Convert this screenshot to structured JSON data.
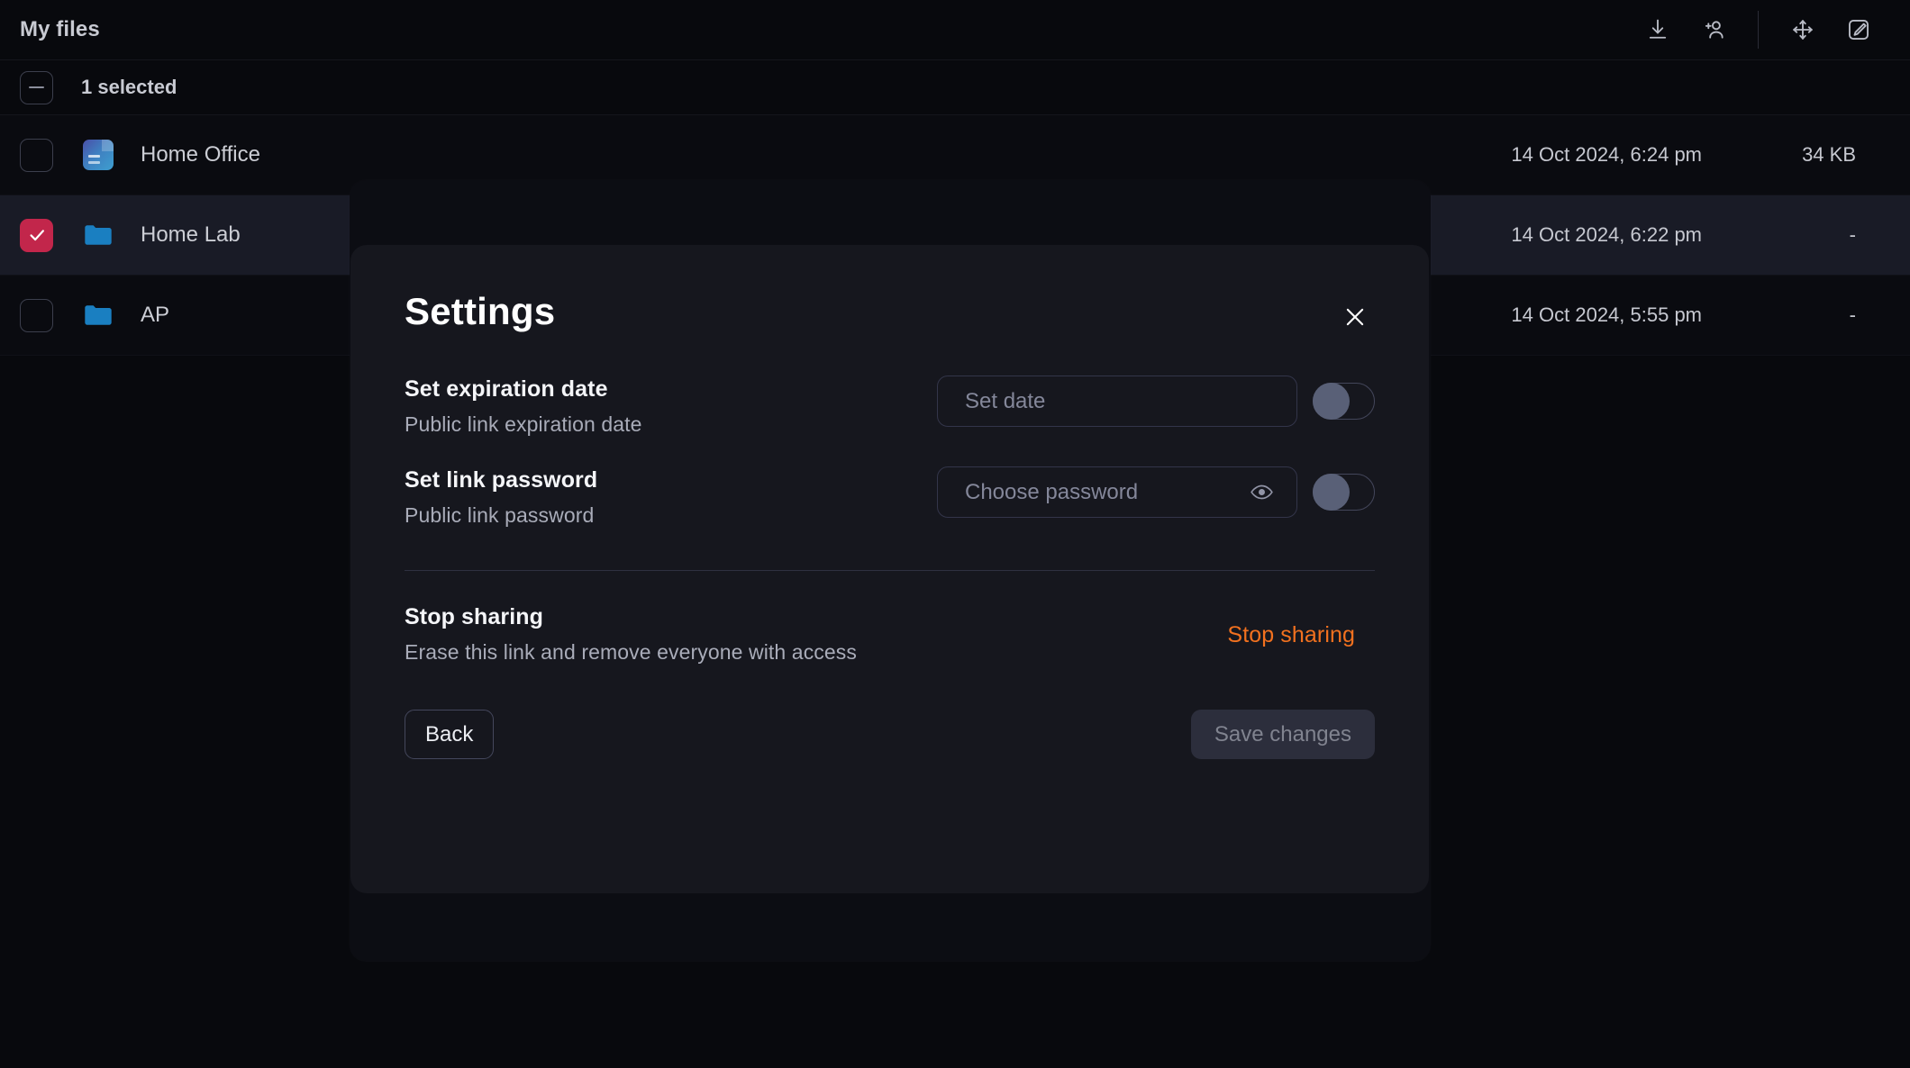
{
  "app": {
    "title": "My files"
  },
  "toolbar": {
    "items": [
      {
        "name": "download-icon",
        "label": "Download"
      },
      {
        "name": "add-person-icon",
        "label": "Share with user"
      },
      {
        "name": "move-icon",
        "label": "Move"
      },
      {
        "name": "rename-icon",
        "label": "Rename"
      }
    ]
  },
  "selection": {
    "count_label": "1 selected",
    "checkbox_state": "indeterminate"
  },
  "files": [
    {
      "name": "Home Office",
      "icon": "document-thumbnail-icon",
      "date": "14 Oct 2024, 6:24 pm",
      "size": "34 KB",
      "selected": false
    },
    {
      "name": "Home Lab",
      "icon": "folder-icon",
      "date": "14 Oct 2024, 6:22 pm",
      "size": "-",
      "selected": true
    },
    {
      "name": "AP",
      "icon": "folder-icon",
      "date": "14 Oct 2024, 5:55 pm",
      "size": "-",
      "selected": false
    }
  ],
  "modal": {
    "title": "Settings",
    "close_icon": "close-icon",
    "expiration": {
      "label": "Set expiration date",
      "sublabel": "Public link expiration date",
      "input_placeholder": "Set date",
      "input_value": "",
      "toggle_on": false
    },
    "password": {
      "label": "Set link password",
      "sublabel": "Public link password",
      "input_placeholder": "Choose password",
      "input_value": "",
      "reveal_icon": "eye-icon",
      "toggle_on": false
    },
    "stop_sharing": {
      "label": "Stop sharing",
      "sublabel": "Erase this link and remove everyone with access",
      "action_label": "Stop sharing"
    },
    "footer": {
      "back_label": "Back",
      "save_label": "Save changes",
      "save_disabled": true
    }
  },
  "colors": {
    "accent_selected": "#c2264b",
    "danger_link": "#f2711f",
    "folder_blue": "#1a7fc1",
    "page_bg": "#08090d",
    "modal_bg": "#16171e",
    "toggle_knob": "#596077"
  }
}
